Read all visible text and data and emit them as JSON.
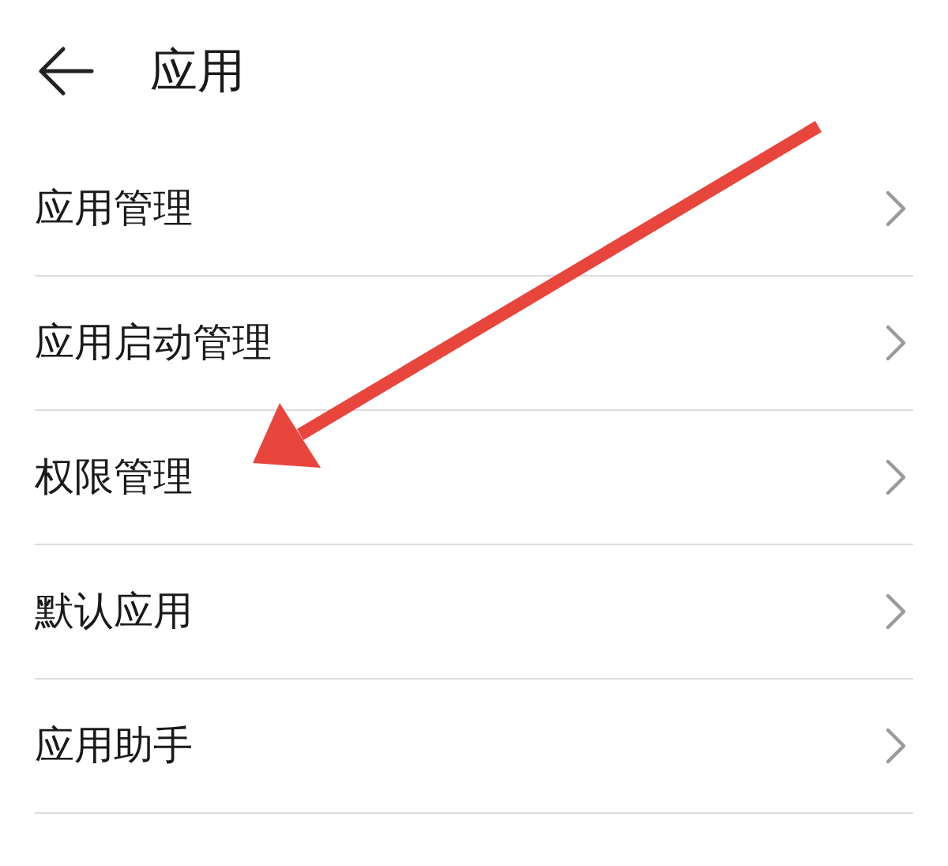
{
  "header": {
    "title": "应用"
  },
  "items": [
    {
      "label": "应用管理"
    },
    {
      "label": "应用启动管理"
    },
    {
      "label": "权限管理"
    },
    {
      "label": "默认应用"
    },
    {
      "label": "应用助手"
    }
  ]
}
